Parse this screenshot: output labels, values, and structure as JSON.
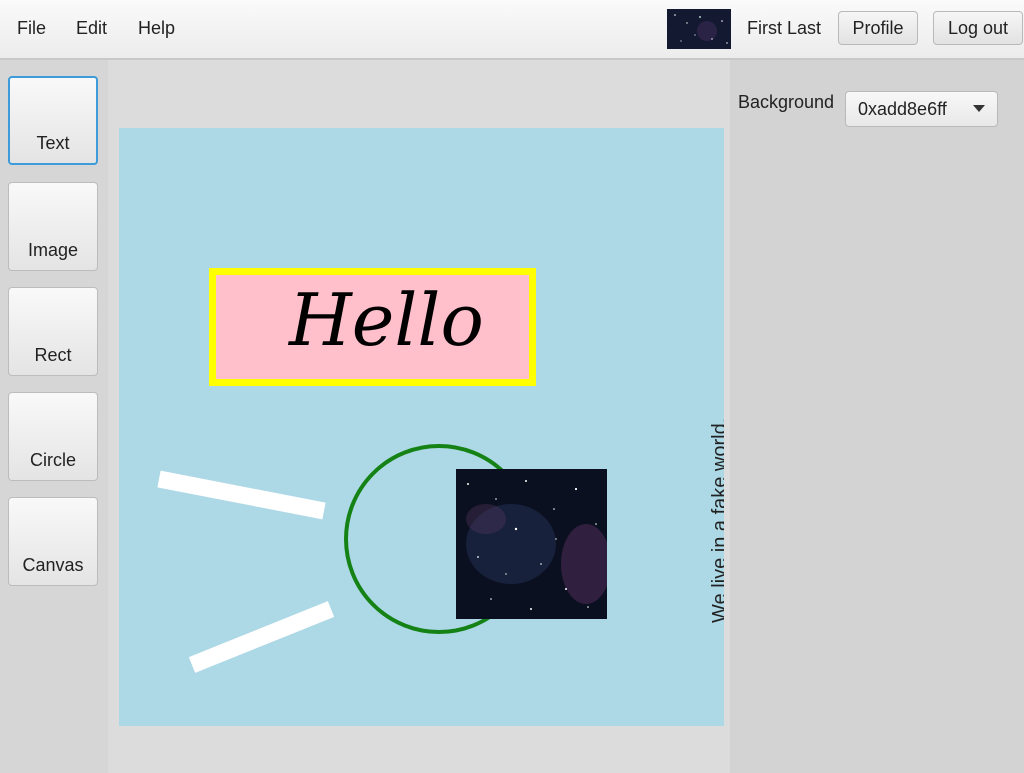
{
  "menu": {
    "file": "File",
    "edit": "Edit",
    "help": "Help"
  },
  "user": {
    "name": "First Last",
    "profile": "Profile",
    "logout": "Log out"
  },
  "tools": [
    "Text",
    "Image",
    "Rect",
    "Circle",
    "Canvas"
  ],
  "canvas": {
    "background_color": "#add8e6",
    "hello_text": "Hello",
    "vertical_text": "We live in a fake world."
  },
  "properties": {
    "background_label": "Background",
    "background_value": "0xadd8e6ff"
  },
  "colors": {
    "hello_fill": "#ffc0cb",
    "hello_border": "#ffff00",
    "circle_stroke": "#148214",
    "line_color": "#ffffff",
    "selected_outline": "#3e9bd9"
  },
  "icons": {
    "user_thumbnail": "starfield-image"
  }
}
